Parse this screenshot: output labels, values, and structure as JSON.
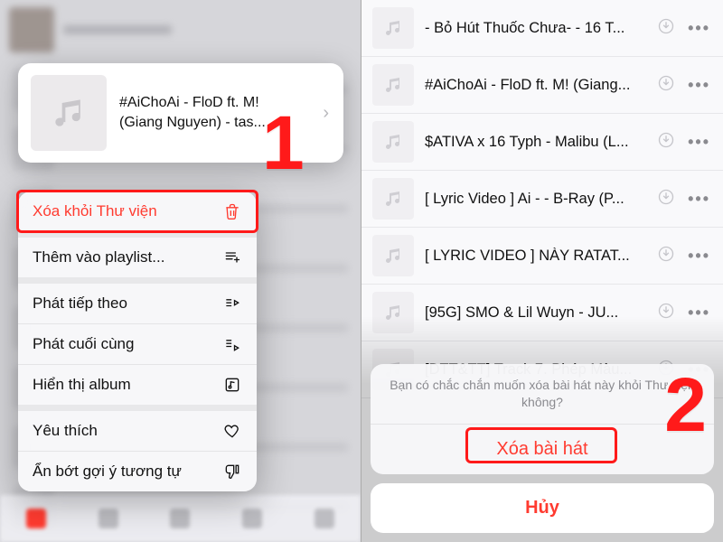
{
  "left": {
    "song_card": {
      "line1": "#AiChoAi - FloD ft. M!",
      "line2": "(Giang Nguyen) - tas..."
    },
    "menu": {
      "delete": "Xóa khỏi Thư viện",
      "add_playlist": "Thêm vào playlist...",
      "play_next": "Phát tiếp theo",
      "play_last": "Phát cuối cùng",
      "show_album": "Hiển thị album",
      "favorite": "Yêu thích",
      "hide_similar": "Ẩn bớt gợi ý tương tự"
    },
    "step_number": "1"
  },
  "right": {
    "songs": [
      "- Bỏ Hút Thuốc Chưa- - 16 T...",
      "#AiChoAi - FloD ft. M! (Giang...",
      "$ATIVA x 16 Typh - Malibu (L...",
      "[ Lyric Video ] Ai - - B-Ray (P...",
      "[ LYRIC VIDEO ] NÀY RATAT...",
      "[95G] SMO & Lil Wuyn - JU...",
      "[DTT&TT] Track 7. Phép Màu..."
    ],
    "sheet": {
      "message": "Bạn có chắc chắn muốn xóa bài hát này khỏi Thư viện không?",
      "delete": "Xóa bài hát",
      "cancel": "Hủy"
    },
    "step_number": "2"
  }
}
